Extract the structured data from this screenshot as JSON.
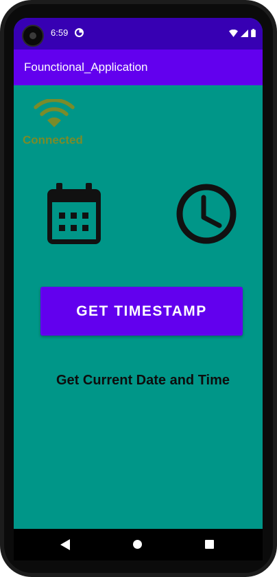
{
  "status_bar": {
    "time": "6:59",
    "notification_icon": "data-saver-icon",
    "icons": [
      "wifi-icon",
      "signal-icon",
      "battery-icon"
    ]
  },
  "app_bar": {
    "title": "Founctional_Application"
  },
  "connection": {
    "icon": "wifi-icon",
    "label": "Connected",
    "color": "#7a8b2a"
  },
  "icons": {
    "left": "calendar-icon",
    "right": "clock-icon"
  },
  "main": {
    "button_label": "GET TIMESTAMP",
    "caption": "Get Current Date and Time"
  },
  "nav_bar": {
    "items": [
      "back-button",
      "home-button",
      "recents-button"
    ]
  },
  "colors": {
    "status_bar": "#3700b3",
    "app_bar": "#6200ee",
    "background": "#009688",
    "button": "#6200ee"
  }
}
